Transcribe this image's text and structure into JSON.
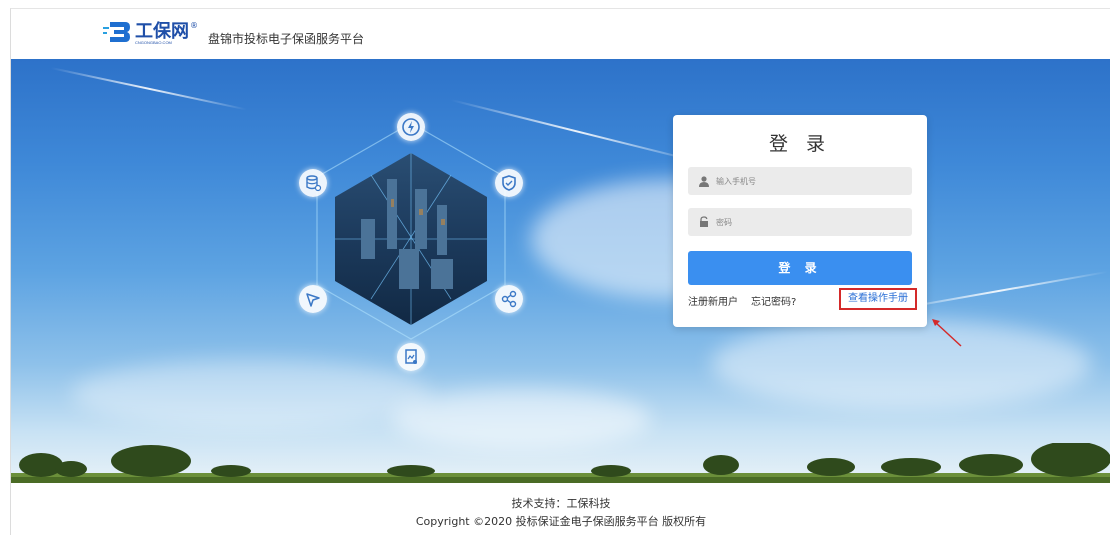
{
  "header": {
    "logo_text": "工保网",
    "logo_sub": "CNGONGBAO.COM",
    "logo_reg": "®",
    "platform_title": "盘锦市投标电子保函服务平台"
  },
  "login": {
    "title": "登 录",
    "phone_placeholder": "输入手机号",
    "password_placeholder": "密码",
    "submit_label": "登 录",
    "register_link": "注册新用户",
    "forgot_link": "忘记密码?",
    "manual_link": "查看操作手册",
    "highlight_color": "#d42a2a",
    "button_color": "#3a8ff0"
  },
  "hero": {
    "icons": [
      "lightning-icon",
      "shield-icon",
      "share-icon",
      "document-icon",
      "send-icon",
      "database-icon"
    ]
  },
  "footer": {
    "tech_support": "技术支持：工保科技",
    "copyright": "Copyright ©2020 投标保证金电子保函服务平台 版权所有"
  }
}
